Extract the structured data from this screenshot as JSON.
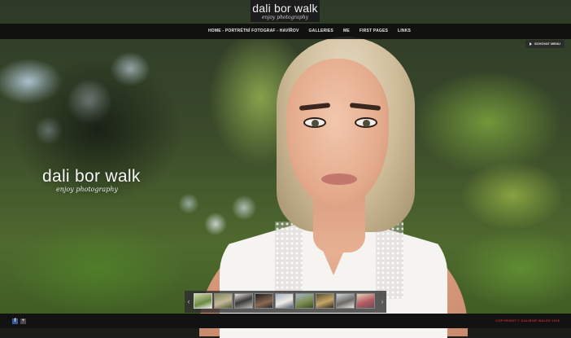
{
  "header": {
    "logo_main": "dali bor walk",
    "logo_sub": "enjoy photography"
  },
  "nav": {
    "items": [
      {
        "label": "HOME - PORTRÉTNÍ FOTOGRAF - HAVÍŘOV"
      },
      {
        "label": "GALLERIES"
      },
      {
        "label": "ME"
      },
      {
        "label": "FIRST PAGES"
      },
      {
        "label": "LINKS"
      }
    ]
  },
  "hide_menu": {
    "label": "SCHOVAT MENU"
  },
  "hero": {
    "logo_main": "dali bor walk",
    "logo_sub": "enjoy photography"
  },
  "thumbnails": {
    "prev_icon": "chevron-left-icon",
    "next_icon": "chevron-right-icon",
    "prev_glyph": "‹",
    "next_glyph": "›",
    "count": 9
  },
  "footer": {
    "facebook_icon": "facebook-icon",
    "share_icon": "share-icon",
    "copyright": "COPYRIGHT © DALIBOR WALEK 2016",
    "copyright_color": "#c8242b"
  },
  "colors": {
    "nav_bg": "#0c0c0c",
    "footer_bg": "#121212",
    "strip_bg": "#2d2d2d",
    "logo_bg": "#1d1d1d"
  }
}
